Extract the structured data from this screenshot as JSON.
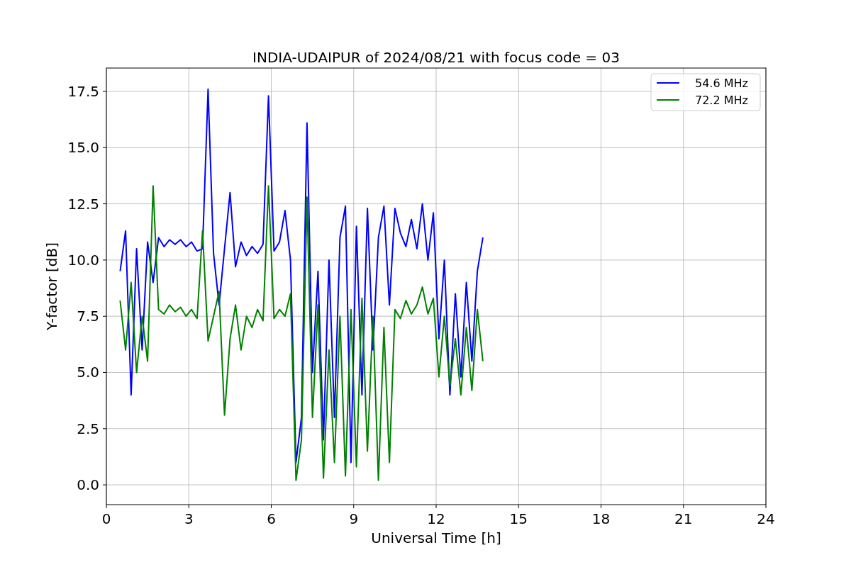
{
  "figure": {
    "chart_data": {
      "type": "line",
      "grid": true,
      "legend": "upper right",
      "title": "INDIA-UDAIPUR of 2024/08/21 with focus code = 03",
      "xlabel": "Universal Time [h]",
      "ylabel": "Y-factor [dB]",
      "xlim": [
        0,
        24
      ],
      "ylim": [
        -0.88,
        18.54
      ],
      "xticks": [
        0,
        3,
        6,
        9,
        12,
        15,
        18,
        21,
        24
      ],
      "yticks": [
        {
          "value": 0,
          "label": "0.0"
        },
        {
          "value": 2.5,
          "label": "2.5"
        },
        {
          "value": 5,
          "label": "5.0"
        },
        {
          "value": 7.5,
          "label": "7.5"
        },
        {
          "value": 10,
          "label": "10.0"
        },
        {
          "value": 12.5,
          "label": "12.5"
        },
        {
          "value": 15,
          "label": "15.0"
        },
        {
          "value": 17.5,
          "label": "17.5"
        }
      ],
      "x": [
        0.5,
        0.7,
        0.9,
        1.1,
        1.3,
        1.5,
        1.7,
        1.9,
        2.1,
        2.3,
        2.5,
        2.7,
        2.9,
        3.1,
        3.3,
        3.5,
        3.7,
        3.9,
        4.1,
        4.3,
        4.5,
        4.7,
        4.9,
        5.1,
        5.3,
        5.5,
        5.7,
        5.9,
        6.1,
        6.3,
        6.5,
        6.7,
        6.9,
        7.1,
        7.3,
        7.5,
        7.7,
        7.9,
        8.1,
        8.3,
        8.5,
        8.7,
        8.9,
        9.1,
        9.3,
        9.5,
        9.7,
        9.9,
        10.1,
        10.3,
        10.5,
        10.7,
        10.9,
        11.1,
        11.3,
        11.5,
        11.7,
        11.9,
        12.1,
        12.3,
        12.5,
        12.7,
        12.9,
        13.1,
        13.3,
        13.5,
        13.7
      ],
      "series": [
        {
          "name": "54.6 MHz",
          "color": "#0000ff",
          "values": [
            9.5,
            11.3,
            4.0,
            10.5,
            6.0,
            10.8,
            9.0,
            11.0,
            10.6,
            10.9,
            10.7,
            10.9,
            10.6,
            10.8,
            10.4,
            10.5,
            17.6,
            10.3,
            8.0,
            10.5,
            13.0,
            9.7,
            10.8,
            10.2,
            10.6,
            10.3,
            10.7,
            17.3,
            10.4,
            10.8,
            12.2,
            10.0,
            1.0,
            3.0,
            16.1,
            5.0,
            9.5,
            2.0,
            10.0,
            3.0,
            11.0,
            12.4,
            1.0,
            11.5,
            4.0,
            12.3,
            6.0,
            11.0,
            12.4,
            8.0,
            12.3,
            11.2,
            10.6,
            11.8,
            10.5,
            12.5,
            10.0,
            12.1,
            6.5,
            10.0,
            4.0,
            8.5,
            4.8,
            9.0,
            5.5,
            9.5,
            11.0
          ]
        },
        {
          "name": "72.2 MHz",
          "color": "#008000",
          "values": [
            8.2,
            6.0,
            9.0,
            5.0,
            7.5,
            5.5,
            13.3,
            7.8,
            7.6,
            8.0,
            7.7,
            7.9,
            7.5,
            7.8,
            7.4,
            11.3,
            6.4,
            7.5,
            8.6,
            3.1,
            6.5,
            8.0,
            6.0,
            7.5,
            7.0,
            7.8,
            7.3,
            13.3,
            7.4,
            7.8,
            7.5,
            8.5,
            0.2,
            2.0,
            12.8,
            3.0,
            8.0,
            0.3,
            6.0,
            1.0,
            7.5,
            0.4,
            7.8,
            0.8,
            8.3,
            1.5,
            7.5,
            0.2,
            7.0,
            1.0,
            7.8,
            7.4,
            8.2,
            7.6,
            8.0,
            8.8,
            7.6,
            8.3,
            4.8,
            7.5,
            4.4,
            6.5,
            4.0,
            7.0,
            4.2,
            7.8,
            5.5
          ]
        }
      ]
    }
  }
}
